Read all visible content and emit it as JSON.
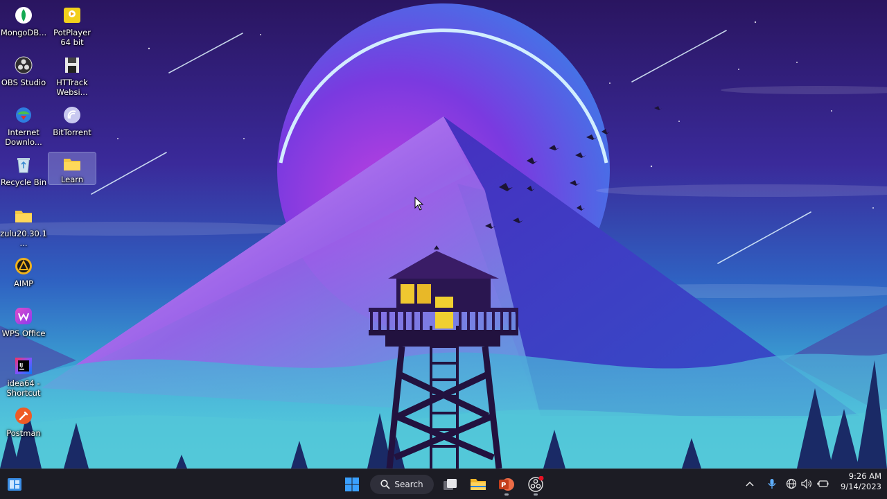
{
  "desktop": {
    "icons": [
      {
        "label": "MongoDB...",
        "icon": "mongodb-icon"
      },
      {
        "label": "PotPlayer 64 bit",
        "icon": "potplayer-icon"
      },
      {
        "label": "OBS Studio",
        "icon": "obs-icon"
      },
      {
        "label": "HTTrack Websi...",
        "icon": "httrack-icon"
      },
      {
        "label": "Internet Downlo...",
        "icon": "idm-icon"
      },
      {
        "label": "BitTorrent",
        "icon": "bittorrent-icon"
      },
      {
        "label": "Recycle Bin",
        "icon": "recycle-bin-icon"
      },
      {
        "label": "Learn",
        "icon": "folder-icon",
        "selected": true
      },
      {
        "label": "zulu20.30.1...",
        "icon": "folder-icon"
      },
      {
        "label": "AIMP",
        "icon": "aimp-icon"
      },
      {
        "label": "WPS Office",
        "icon": "wps-icon"
      },
      {
        "label": "idea64 - Shortcut",
        "icon": "intellij-icon"
      },
      {
        "label": "Postman",
        "icon": "postman-icon"
      }
    ]
  },
  "taskbar": {
    "search_label": "Search",
    "clock": {
      "time": "9:26 AM",
      "date": "9/14/2023"
    },
    "colors": {
      "background": "#1c1c24",
      "accent": "#3aa0ff"
    }
  }
}
